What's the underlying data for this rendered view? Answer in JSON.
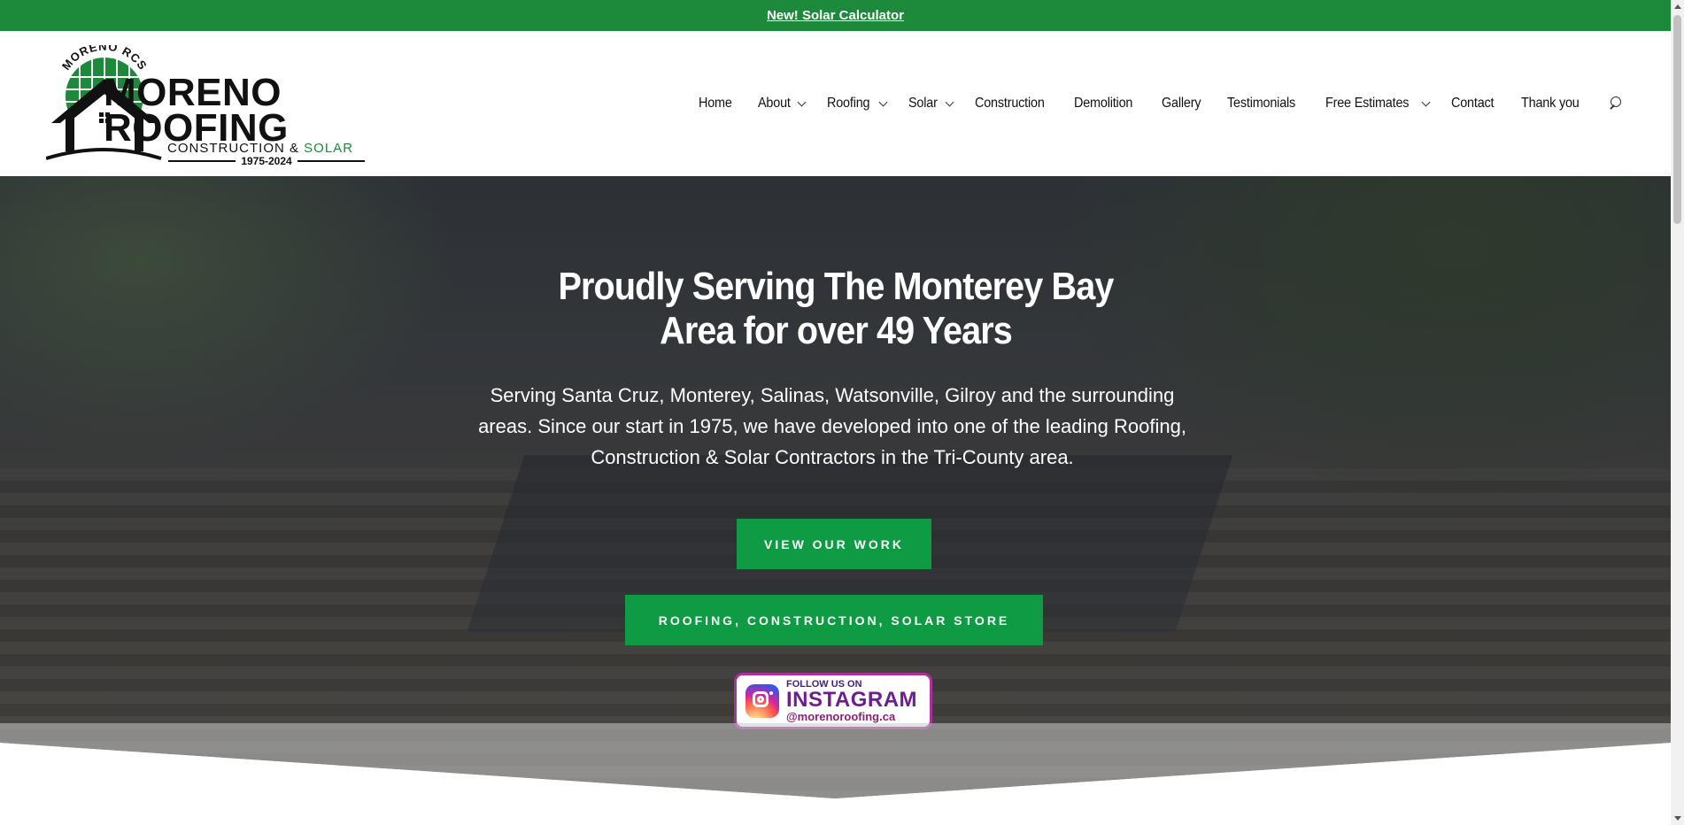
{
  "promo": {
    "link_text": "New! Solar Calculator"
  },
  "logo": {
    "arc_text": "MORENO RCS",
    "line1": "MORENO",
    "line2": "ROOFING",
    "sub_construction": "CONSTRUCTION &",
    "sub_solar": "SOLAR",
    "years": "1975-2024"
  },
  "nav": {
    "items": [
      {
        "label": "Home",
        "dropdown": false
      },
      {
        "label": "About",
        "dropdown": true
      },
      {
        "label": "Roofing",
        "dropdown": true
      },
      {
        "label": "Solar",
        "dropdown": true
      },
      {
        "label": "Construction",
        "dropdown": false
      },
      {
        "label": "Demolition",
        "dropdown": false
      },
      {
        "label": "Gallery",
        "dropdown": false
      },
      {
        "label": "Testimonials",
        "dropdown": false
      },
      {
        "label": "Free Estimates",
        "dropdown": true
      },
      {
        "label": "Contact",
        "dropdown": false
      },
      {
        "label": "Thank you",
        "dropdown": false
      }
    ],
    "search_icon": "search-icon"
  },
  "hero": {
    "title": "Proudly Serving The Monterey Bay Area for over 49 Years",
    "description": "Serving Santa Cruz, Monterey, Salinas, Watsonville, Gilroy and the surrounding areas.  Since our start in 1975, we have developed into one of the leading Roofing, Construction & Solar Contractors in the Tri-County area.",
    "btn_work": "View Our Work",
    "btn_store": "Roofing, Construction, Solar Store"
  },
  "instagram": {
    "line1": "FOLLOW US ON",
    "line2": "INSTAGRAM",
    "line3": "@morenoroofing.ca"
  },
  "colors": {
    "brand_green": "#1c8a3a",
    "button_green": "#0f9a44",
    "instagram_purple": "#6e1e8f"
  }
}
